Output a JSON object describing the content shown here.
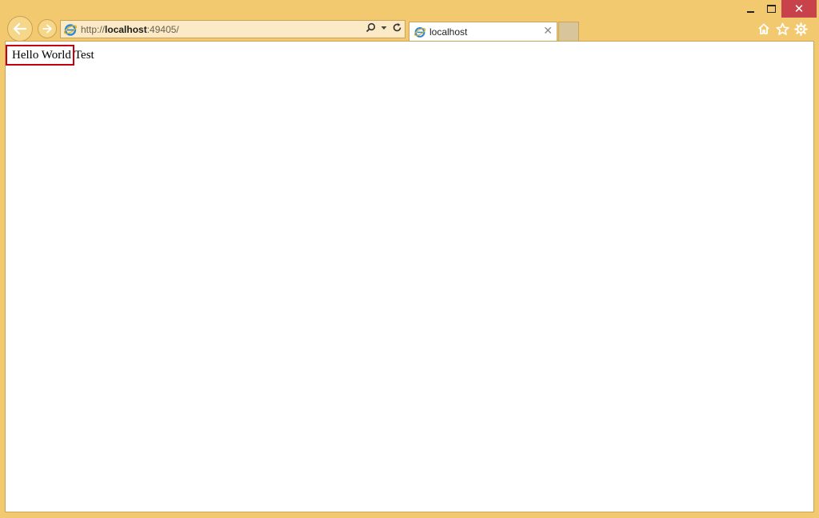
{
  "window": {
    "controls": {
      "minimize": "minimize",
      "maximize": "maximize",
      "close": "✕"
    }
  },
  "address_bar": {
    "url_prefix": "http://",
    "url_host": "localhost",
    "url_suffix": ":49405/"
  },
  "tabs": [
    {
      "label": "localhost",
      "close": "✕"
    }
  ],
  "toolbar_icons": [
    "home-icon",
    "star-icon",
    "gear-icon"
  ],
  "page": {
    "highlighted_text": "Hello World",
    "trailing_text": "Test"
  },
  "colors": {
    "frame": "#f2c96e",
    "close_button": "#c7424a",
    "highlight_border": "#c2000f"
  }
}
